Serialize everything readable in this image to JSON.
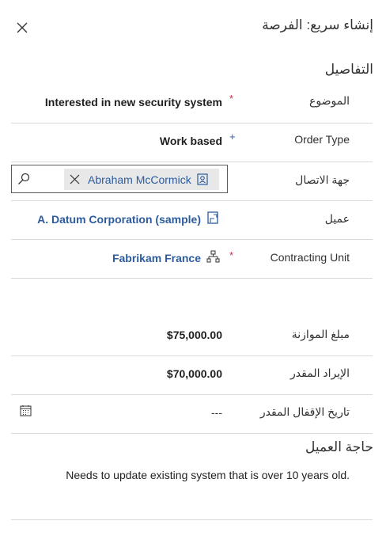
{
  "header": {
    "title": "إنشاء سريع: الفرصة",
    "close_icon": "close-icon"
  },
  "sections": {
    "details": "التفاصيل",
    "customer_need": "حاجة العميل"
  },
  "fields": {
    "topic": {
      "label": "الموضوع",
      "value": "Interested in new security system",
      "required": true
    },
    "order_type": {
      "label": "Order Type",
      "value": "Work based",
      "recommended": true
    },
    "contact": {
      "label": "جهة الاتصال",
      "value": "Abraham McCormick",
      "search_icon": "search-icon",
      "remove_icon": "close-icon",
      "entity_icon": "contact-card-icon"
    },
    "customer": {
      "label": "عميل",
      "value": "A. Datum Corporation (sample)",
      "entity_icon": "account-icon"
    },
    "contracting_unit": {
      "label": "Contracting Unit",
      "value": "Fabrikam France",
      "required": true,
      "entity_icon": "org-hierarchy-icon"
    },
    "budget": {
      "label": "مبلغ الموازنة",
      "value": "$75,000.00"
    },
    "est_revenue": {
      "label": "الإيراد المقدر",
      "value": "$70,000.00"
    },
    "est_close_date": {
      "label": "تاريخ الإقفال المقدر",
      "value": "---",
      "calendar_icon": "calendar-icon"
    }
  },
  "customer_need_text": "Needs to update existing system that is over 10 years old.",
  "markers": {
    "required": "*",
    "recommended": "+"
  },
  "colors": {
    "link": "#2c5b9e",
    "required": "#c4314b",
    "divider": "#dadada"
  }
}
